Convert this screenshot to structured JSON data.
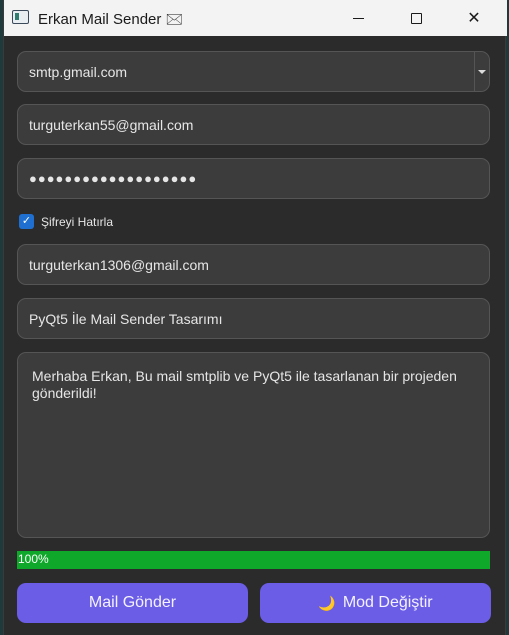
{
  "window": {
    "title": "Erkan Mail Sender 🖂",
    "controls": {
      "minimize": "minimize",
      "maximize": "maximize",
      "close": "✕"
    }
  },
  "smtp": {
    "selected": "smtp.gmail.com"
  },
  "sender": {
    "email": "turguterkan55@gmail.com",
    "password_mask": "●●●●●●●●●●●●●●●●●●●"
  },
  "remember": {
    "label": "Şifreyi Hatırla",
    "checked": true
  },
  "recipient": {
    "email": "turguterkan1306@gmail.com"
  },
  "subject": {
    "value": "PyQt5 İle Mail Sender Tasarımı"
  },
  "message": {
    "body": "Merhaba Erkan, Bu mail smtplib ve PyQt5 ile tasarlanan bir projeden gönderildi!"
  },
  "progress": {
    "value": 100,
    "label": "100%"
  },
  "buttons": {
    "send": "Mail Gönder",
    "mode_icon": "🌙",
    "mode": "Mod Değiştir"
  },
  "colors": {
    "accent": "#6b5de6",
    "progress": "#0fa82a",
    "checkbox": "#1f6fd1"
  }
}
